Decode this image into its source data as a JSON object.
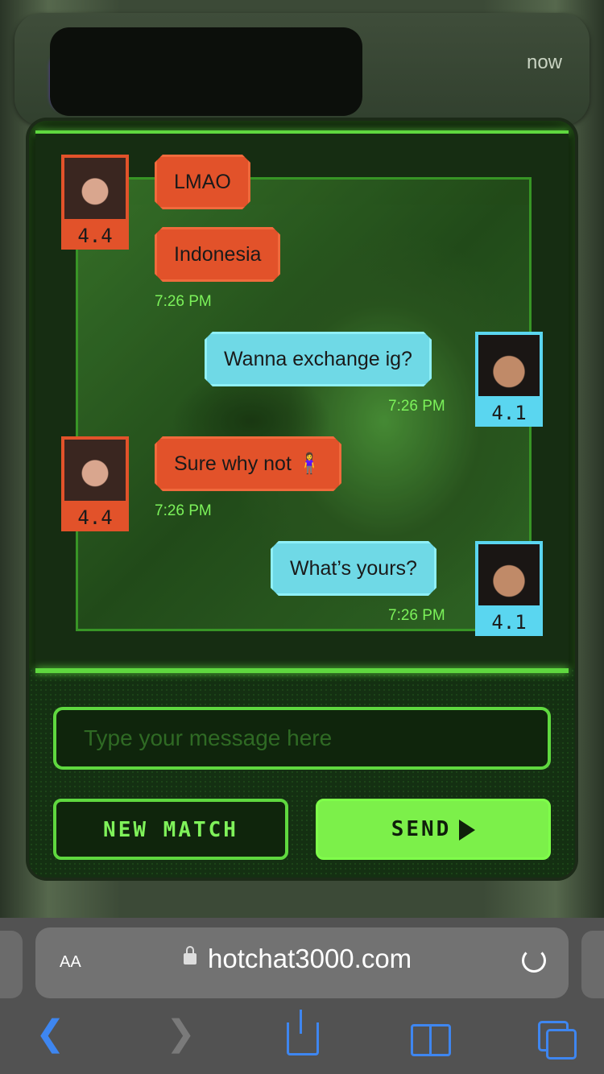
{
  "notification": {
    "time": "now"
  },
  "messages": [
    {
      "sender": "her",
      "text": "LMAO"
    },
    {
      "sender": "her",
      "text": "Indonesia",
      "time": "7:26 PM"
    },
    {
      "sender": "him",
      "text": "Wanna exchange ig?",
      "time": "7:26 PM"
    },
    {
      "sender": "her",
      "text": "Sure why not 🧍‍♀️",
      "time": "7:26 PM"
    },
    {
      "sender": "him",
      "text": "What’s yours?",
      "time": "7:26 PM"
    }
  ],
  "ratings": {
    "her": "4.4",
    "him": "4.1"
  },
  "input": {
    "placeholder": "Type your message here"
  },
  "buttons": {
    "new_match": "NEW MATCH",
    "send": "SEND"
  },
  "browser": {
    "aa": "AA",
    "url": "hotchat3000.com"
  },
  "icons": [
    "back-icon",
    "forward-icon",
    "share-icon",
    "bookmarks-icon",
    "tabs-icon",
    "lock-icon",
    "reload-icon",
    "send-arrow-icon"
  ]
}
